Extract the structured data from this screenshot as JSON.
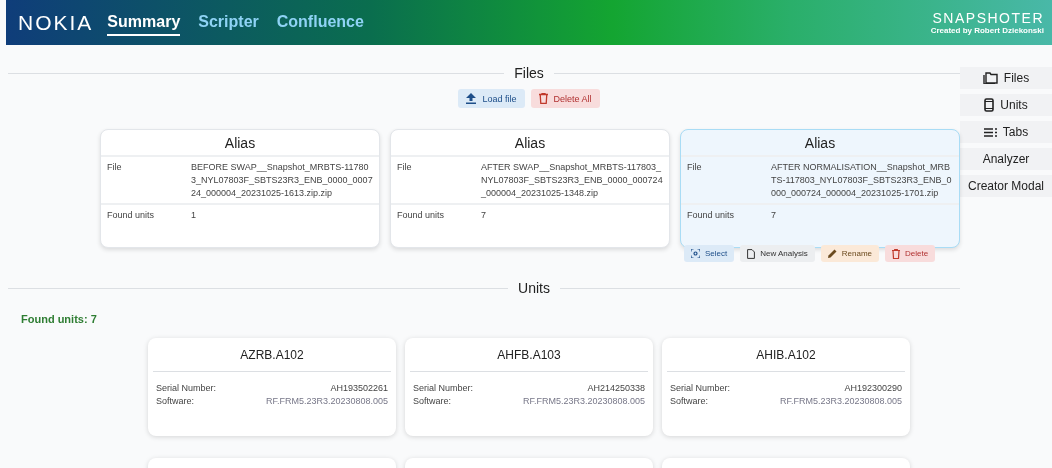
{
  "header": {
    "logo": "NOKIA",
    "tabs": [
      {
        "label": "Summary",
        "selected": true
      },
      {
        "label": "Scripter",
        "selected": false
      },
      {
        "label": "Confluence",
        "selected": false
      }
    ],
    "app_title": "SNAPSHOTER",
    "credit": "Created by Robert Dziekonski"
  },
  "files": {
    "title": "Files",
    "load_button": "Load file",
    "delete_all_button": "Delete All",
    "cards": [
      {
        "alias": "Alias",
        "file_label": "File",
        "file": "BEFORE SWAP__Snapshot_MRBTS-117803_NYL07803F_SBTS23R3_ENB_0000_000724_000004_20231025-1613.zip.zip",
        "units_label": "Found units",
        "units": "1",
        "selected": false
      },
      {
        "alias": "Alias",
        "file_label": "File",
        "file": "AFTER SWAP__Snapshot_MRBTS-117803_NYL07803F_SBTS23R3_ENB_0000_000724_000004_20231025-1348.zip",
        "units_label": "Found units",
        "units": "7",
        "selected": false
      },
      {
        "alias": "Alias",
        "file_label": "File",
        "file": "AFTER NORMALISATION__Snapshot_MRBTS-117803_NYL07803F_SBTS23R3_ENB_0000_000724_000004_20231025-1701.zip",
        "units_label": "Found units",
        "units": "7",
        "selected": true
      }
    ],
    "actions": [
      "Select",
      "New Analysis",
      "Rename",
      "Delete"
    ]
  },
  "units": {
    "title": "Units",
    "found": "Found units: 7",
    "cards": [
      {
        "name": "AZRB.A102",
        "serial_label": "Serial Number:",
        "serial": "AH193502261",
        "software_label": "Software:",
        "software": "RF.FRM5.23R3.20230808.005"
      },
      {
        "name": "AHFB.A103",
        "serial_label": "Serial Number:",
        "serial": "AH214250338",
        "software_label": "Software:",
        "software": "RF.FRM5.23R3.20230808.005"
      },
      {
        "name": "AHIB.A102",
        "serial_label": "Serial Number:",
        "serial": "AH192300290",
        "software_label": "Software:",
        "software": "RF.FRM5.23R3.20230808.005"
      }
    ]
  },
  "side_nav": [
    "Files",
    "Units",
    "Tabs",
    "Analyzer",
    "Creator Modal"
  ]
}
